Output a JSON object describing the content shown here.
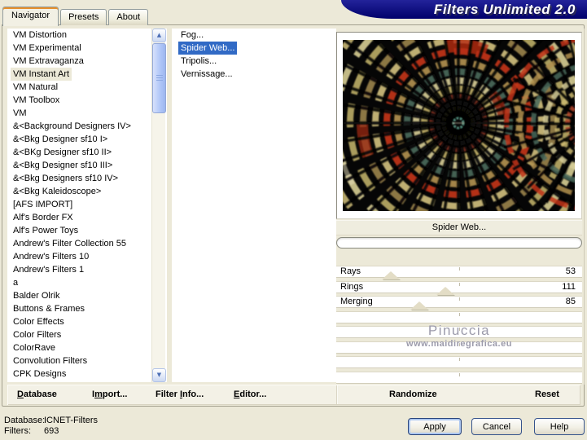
{
  "window": {
    "title": "Filters Unlimited 2.0"
  },
  "tabs": [
    {
      "label": "Navigator",
      "active": true
    },
    {
      "label": "Presets",
      "active": false
    },
    {
      "label": "About",
      "active": false
    }
  ],
  "left_list": {
    "selected_index": 3,
    "items": [
      "VM Distortion",
      "VM Experimental",
      "VM Extravaganza",
      "VM Instant Art",
      "VM Natural",
      "VM Toolbox",
      "VM",
      "&<Background Designers IV>",
      "&<Bkg Designer sf10 I>",
      "&<BKg Designer sf10 II>",
      "&<Bkg Designer sf10 III>",
      "&<Bkg Designers sf10 IV>",
      "&<Bkg Kaleidoscope>",
      "[AFS IMPORT]",
      "Alf's Border FX",
      "Alf's Power Toys",
      "Andrew's Filter Collection 55",
      "Andrew's Filters 10",
      "Andrew's Filters 1",
      "a",
      "Balder Olrik",
      "Buttons & Frames",
      "Color Effects",
      "Color Filters",
      "ColorRave",
      "Convolution Filters",
      "CPK Designs"
    ]
  },
  "filter_list": {
    "selected_index": 1,
    "items": [
      "Fog...",
      "Spider Web...",
      "Tripolis...",
      "Vernissage..."
    ]
  },
  "preview": {
    "filter_name": "Spider Web...",
    "watermark": {
      "line1": "Pinuccia",
      "line2": "www.maidiregrafica.eu"
    }
  },
  "sliders": [
    {
      "label": "Rays",
      "value": "53",
      "thumb_frac": 0.21
    },
    {
      "label": "Rings",
      "value": "111",
      "thumb_frac": 0.44
    },
    {
      "label": "Merging",
      "value": "85",
      "thumb_frac": 0.33
    }
  ],
  "empty_slider_rows": 5,
  "menu": {
    "left": [
      {
        "pre": "",
        "key": "D",
        "post": "atabase"
      },
      {
        "pre": "I",
        "key": "m",
        "post": "port..."
      },
      {
        "pre": "Filter ",
        "key": "I",
        "post": "nfo..."
      },
      {
        "pre": "",
        "key": "E",
        "post": "ditor..."
      }
    ],
    "right": [
      {
        "label": "Randomize"
      },
      {
        "label": "Reset"
      }
    ]
  },
  "status": {
    "database_label": "Database:",
    "database_value": "ICNET-Filters",
    "filters_label": "Filters:",
    "filters_value": "693"
  },
  "buttons": [
    {
      "label": "Apply"
    },
    {
      "label": "Cancel"
    },
    {
      "label": "Help"
    }
  ],
  "icons": {
    "scroll_up": "▲",
    "scroll_down": "▼"
  },
  "colors": {
    "window_bg": "#ECE9D8",
    "title_band": "#000080",
    "selection_blue": "#316AC5",
    "active_tab_stripe": "#E7902C",
    "list_bg": "#FFFFFF"
  }
}
